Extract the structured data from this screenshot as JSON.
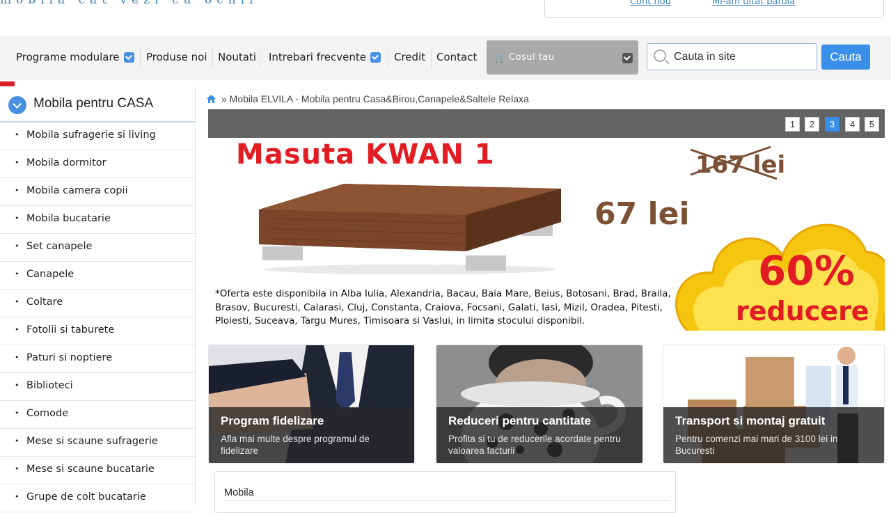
{
  "header": {
    "tagline": "mobila cat vezi cu ochii",
    "account_link": "Cont nou",
    "forgot_link": "Mi-am uitat parola"
  },
  "nav": {
    "items": [
      {
        "label": "Programe modulare",
        "dropdown": true
      },
      {
        "label": "Produse noi",
        "dropdown": false
      },
      {
        "label": "Noutati",
        "dropdown": false
      },
      {
        "label": "Intrebari frecvente",
        "dropdown": true
      },
      {
        "label": "Credit",
        "dropdown": false
      },
      {
        "label": "Contact",
        "dropdown": false
      }
    ],
    "cart_label": "Cosul tau",
    "search_placeholder": "Cauta in site",
    "search_button": "Cauta"
  },
  "sidebar": {
    "title": "Mobila pentru CASA",
    "items": [
      "Mobila sufragerie si living",
      "Mobila dormitor",
      "Mobila camera copii",
      "Mobila bucatarie",
      "Set canapele",
      "Canapele",
      "Coltare",
      "Fotolii si taburete",
      "Paturi si noptiere",
      "Biblioteci",
      "Comode",
      "Mese si scaune sufragerie",
      "Mese si scaune bucatarie",
      "Grupe de colt bucatarie"
    ]
  },
  "breadcrumb": {
    "text": "» Mobila ELVILA - Mobila pentru Casa&Birou,Canapele&Saltele Relaxa"
  },
  "banner": {
    "pages": [
      "1",
      "2",
      "3",
      "4",
      "5"
    ],
    "active_page": 3,
    "title": "Masuta KWAN 1",
    "old_price": "167 lei",
    "new_price": "67 lei",
    "discount_percent": "60%",
    "discount_word": "reducere",
    "note": "*Oferta este disponibila in Alba Iulia, Alexandria, Bacau, Baia Mare, Beius, Botosani, Brad, Braila, Brasov, Bucuresti, Calarasi, Cluj, Constanta, Craiova, Focsani, Galati, Iasi, Mizil, Oradea, Pitesti, Ploiesti, Suceava, Targu Mures, Timisoara si Vaslui, in limita stocului disponibil."
  },
  "tiles": [
    {
      "title": "Program fidelizare",
      "desc": "Afla mai multe despre programul de fidelizare"
    },
    {
      "title": "Reduceri pentru cantitate",
      "desc": "Profita si tu de reducerile acordate pentru valoarea facturii"
    },
    {
      "title": "Transport si montaj gratuit",
      "desc": "Pentru comenzi mai mari de 3100 lei in Bucuresti"
    }
  ],
  "section": {
    "title": "Mobila"
  },
  "colors": {
    "accent": "#3a8fe8",
    "promo_red": "#e21c23",
    "price_brown": "#7b5034",
    "banner_bar": "#636363"
  }
}
